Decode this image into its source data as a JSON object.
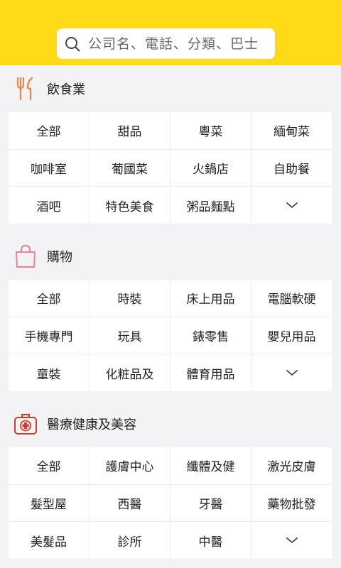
{
  "search": {
    "placeholder": "公司名、電話、分類、巴士"
  },
  "sections": [
    {
      "title": "飲食業",
      "icon": "fork-knife-icon",
      "items": [
        "全部",
        "甜品",
        "粵菜",
        "緬甸菜",
        "咖啡室",
        "葡國菜",
        "火鍋店",
        "自助餐",
        "酒吧",
        "特色美食",
        "粥品麵點"
      ]
    },
    {
      "title": "購物",
      "icon": "shopping-bag-icon",
      "items": [
        "全部",
        "時裝",
        "床上用品",
        "電腦軟硬",
        "手機專門",
        "玩具",
        "錶零售",
        "嬰兒用品",
        "童裝",
        "化粧品及",
        "體育用品"
      ]
    },
    {
      "title": "醫療健康及美容",
      "icon": "medical-kit-icon",
      "items": [
        "全部",
        "護膚中心",
        "纖體及健",
        "激光皮膚",
        "髮型屋",
        "西醫",
        "牙醫",
        "藥物批發",
        "美髮品",
        "診所",
        "中醫"
      ]
    }
  ],
  "colors": {
    "header": "#ffdb17",
    "dining_icon": "#e8884a",
    "shopping_icon": "#e8829a",
    "medical_icon": "#d83a2e"
  }
}
